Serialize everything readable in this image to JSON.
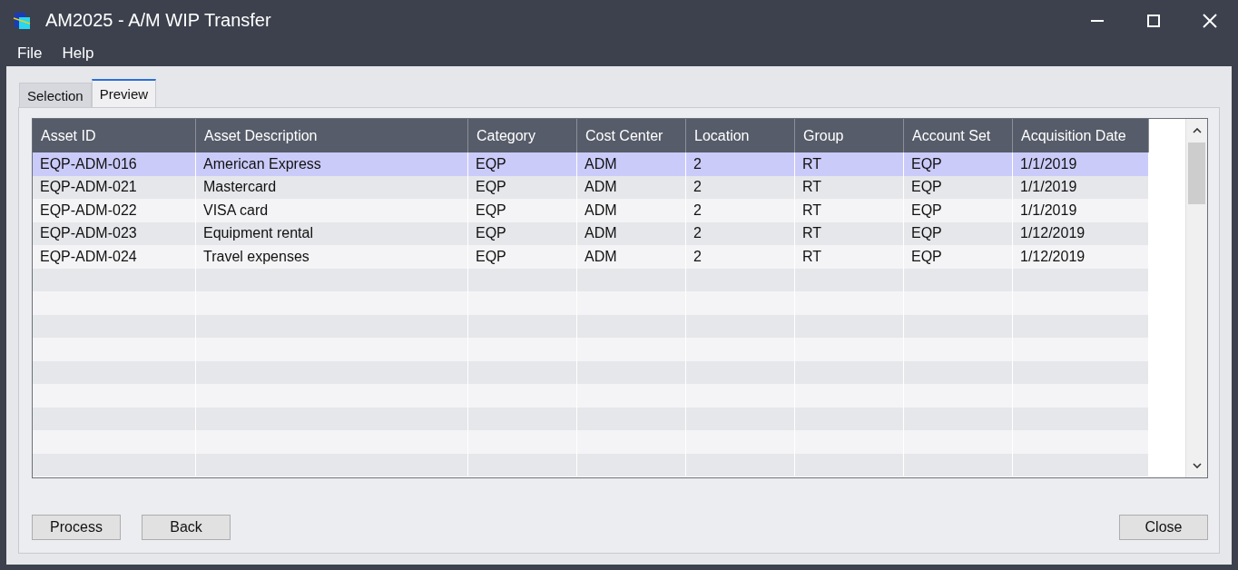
{
  "window": {
    "title": "AM2025 - A/M WIP Transfer"
  },
  "menu": [
    "File",
    "Help"
  ],
  "tabs": [
    {
      "label": "Selection",
      "selected": false
    },
    {
      "label": "Preview",
      "selected": true
    }
  ],
  "table": {
    "columns": [
      "Asset ID",
      "Asset Description",
      "Category",
      "Cost Center",
      "Location",
      "Group",
      "Account Set",
      "Acquisition Date"
    ],
    "rows": [
      {
        "selected": true,
        "cells": [
          "EQP-ADM-016",
          "American Express",
          "EQP",
          "ADM",
          "2",
          "RT",
          "EQP",
          "1/1/2019"
        ]
      },
      {
        "selected": false,
        "cells": [
          "EQP-ADM-021",
          "Mastercard",
          "EQP",
          "ADM",
          "2",
          "RT",
          "EQP",
          "1/1/2019"
        ]
      },
      {
        "selected": false,
        "cells": [
          "EQP-ADM-022",
          "VISA card",
          "EQP",
          "ADM",
          "2",
          "RT",
          "EQP",
          "1/1/2019"
        ]
      },
      {
        "selected": false,
        "cells": [
          "EQP-ADM-023",
          "Equipment rental",
          "EQP",
          "ADM",
          "2",
          "RT",
          "EQP",
          "1/12/2019"
        ]
      },
      {
        "selected": false,
        "cells": [
          "EQP-ADM-024",
          "Travel expenses",
          "EQP",
          "ADM",
          "2",
          "RT",
          "EQP",
          "1/12/2019"
        ]
      }
    ]
  },
  "buttons_left": [
    "Process",
    "Back"
  ],
  "buttons_right": [
    "Close"
  ]
}
